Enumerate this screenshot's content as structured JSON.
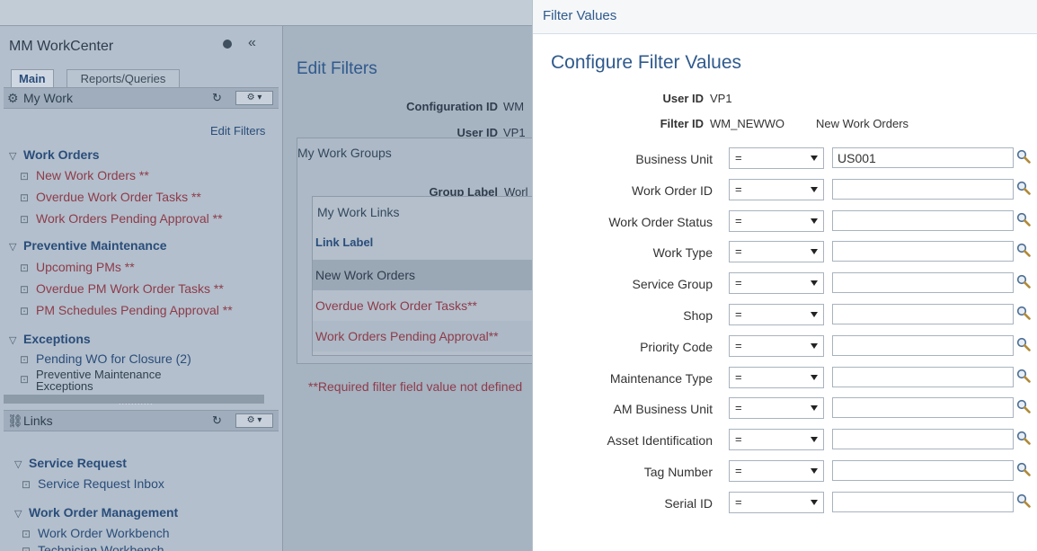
{
  "workcenter": {
    "title": "MM WorkCenter",
    "collapse": "«",
    "tabs": [
      "Main",
      "Reports/Queries"
    ],
    "my_work": {
      "title": "My Work",
      "edit_filters": "Edit Filters",
      "sections": [
        {
          "label": "Work Orders",
          "items": [
            "New Work Orders **",
            "Overdue Work Order Tasks **",
            "Work Orders Pending Approval **"
          ]
        },
        {
          "label": "Preventive Maintenance",
          "items": [
            "Upcoming PMs **",
            "Overdue PM Work Order Tasks **",
            "PM Schedules Pending Approval **"
          ]
        },
        {
          "label": "Exceptions",
          "items": [
            "Pending WO for Closure (2)",
            "Preventive Maintenance",
            "Exceptions"
          ]
        }
      ],
      "splitter": "..........."
    },
    "links": {
      "title": "Links",
      "sections": [
        {
          "label": "Service Request",
          "items": [
            "Service Request Inbox"
          ]
        },
        {
          "label": "Work Order Management",
          "items": [
            "Work Order Workbench",
            "Technician Workbench"
          ]
        }
      ]
    }
  },
  "edit_filters": {
    "title": "Edit Filters",
    "config_label": "Configuration ID",
    "config_value": "WM",
    "user_label": "User ID",
    "user_value": "VP1",
    "group_box": "My Work Groups",
    "group_label": "Group Label",
    "group_value": "Worl",
    "links_box": "My Work Links",
    "link_label_header": "Link Label",
    "rows": [
      "New Work Orders",
      "Overdue Work Order Tasks**",
      "Work Orders Pending Approval**"
    ],
    "required_msg": "**Required filter field value not defined"
  },
  "modal": {
    "bar_title": "Filter Values",
    "title": "Configure Filter Values",
    "user_id_label": "User ID",
    "user_id_value": "VP1",
    "filter_id_label": "Filter ID",
    "filter_id_value": "WM_NEWWO",
    "filter_desc": "New Work Orders",
    "fields": [
      {
        "label": "Business Unit",
        "operator": "=",
        "value": "US001"
      },
      {
        "label": "Work Order ID",
        "operator": "=",
        "value": ""
      },
      {
        "label": "Work Order Status",
        "operator": "=",
        "value": ""
      },
      {
        "label": "Work Type",
        "operator": "=",
        "value": ""
      },
      {
        "label": "Service Group",
        "operator": "=",
        "value": ""
      },
      {
        "label": "Shop",
        "operator": "=",
        "value": ""
      },
      {
        "label": "Priority Code",
        "operator": "=",
        "value": ""
      },
      {
        "label": "Maintenance Type",
        "operator": "=",
        "value": ""
      },
      {
        "label": "AM Business Unit",
        "operator": "=",
        "value": ""
      },
      {
        "label": "Asset Identification",
        "operator": "=",
        "value": ""
      },
      {
        "label": "Tag Number",
        "operator": "=",
        "value": ""
      },
      {
        "label": "Serial ID",
        "operator": "=",
        "value": ""
      }
    ]
  },
  "colors": {
    "accent": "#2f5a8c",
    "link_red": "#8e3b4a",
    "overlay": "#a6b3c1"
  }
}
